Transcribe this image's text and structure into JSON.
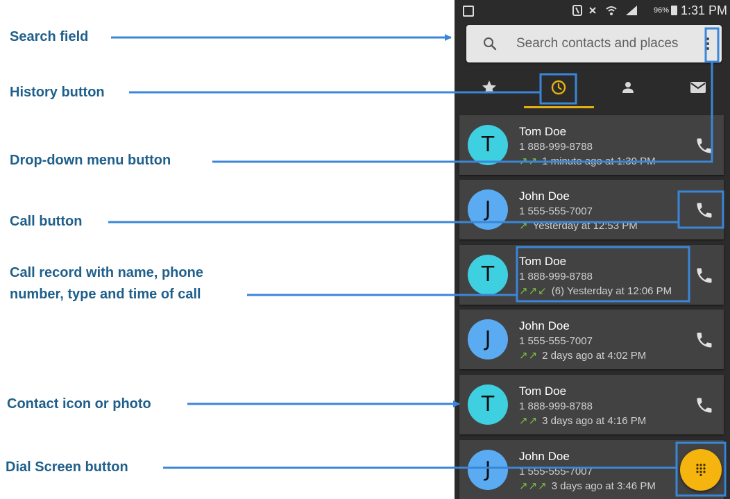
{
  "callouts": {
    "search_field": "Search field",
    "history_button": "History button",
    "dropdown_menu_button": "Drop-down menu button",
    "call_button": "Call button",
    "call_record_line1": "Call record with name, phone",
    "call_record_line2": "number, type and time of call",
    "contact_icon": "Contact icon or photo",
    "dial_screen_button": "Dial Screen button"
  },
  "colors": {
    "callout_text": "#1f5f8b",
    "callout_line": "#3a86d8",
    "phone_bg": "#2b2b2b",
    "card_bg": "#424242",
    "tab_active": "#e6b012",
    "fab": "#f5b40e",
    "avatar_teal": "#3ecfe0",
    "avatar_blue": "#5aabf2",
    "arrow_green": "#7bc043"
  },
  "status_bar": {
    "battery": "96%",
    "time": "1:31 PM"
  },
  "search": {
    "placeholder": "Search contacts and places"
  },
  "tabs": [
    {
      "icon": "star-icon",
      "active": false
    },
    {
      "icon": "clock-icon",
      "active": true
    },
    {
      "icon": "person-icon",
      "active": false
    },
    {
      "icon": "mail-icon",
      "active": false
    }
  ],
  "calls": [
    {
      "initial": "T",
      "name": "Tom Doe",
      "number": "1 888-999-8788",
      "arrows": "↗↗",
      "count": "",
      "time": "1 minute ago at 1:30 PM"
    },
    {
      "initial": "J",
      "name": "John Doe",
      "number": "1 555-555-7007",
      "arrows": "↗",
      "count": "",
      "time": "Yesterday at 12:53 PM"
    },
    {
      "initial": "T",
      "name": "Tom Doe",
      "number": "1 888-999-8788",
      "arrows": "↗↗↙",
      "count": "(6)",
      "time": "Yesterday at 12:06 PM"
    },
    {
      "initial": "J",
      "name": "John Doe",
      "number": "1 555-555-7007",
      "arrows": "↗↗",
      "count": "",
      "time": "2 days ago at 4:02 PM"
    },
    {
      "initial": "T",
      "name": "Tom Doe",
      "number": "1 888-999-8788",
      "arrows": "↗↗",
      "count": "",
      "time": "3 days ago at 4:16 PM"
    },
    {
      "initial": "J",
      "name": "John Doe",
      "number": "1 555-555-7007",
      "arrows": "↗↗↗",
      "count": "",
      "time": "3 days ago at 3:46 PM"
    }
  ]
}
